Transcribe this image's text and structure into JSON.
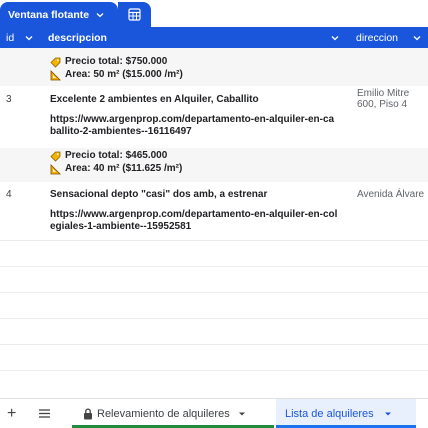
{
  "toolbar": {
    "view_tab_label": "Ventana flotante",
    "view_tab_icon": "chevron-down-icon",
    "table_icon": "table-icon"
  },
  "columns": {
    "id": "id",
    "description": "descripcion",
    "address": "direccion"
  },
  "rows": [
    {
      "id": "",
      "title": "",
      "url": "",
      "price": "Precio total: $750.000",
      "area": "Area:  50 m² ($15.000 /m²)",
      "address": ""
    },
    {
      "id": "3",
      "title": "Excelente 2 ambientes en Alquiler, Caballito",
      "url": "https://www.argenprop.com/departamento-en-alquiler-en-caballito-2-ambientes--16116497",
      "price": "Precio total: $465.000",
      "area": "Area:  40 m² ($11.625 /m²)",
      "address": "Emilio Mitre 600, Piso 4"
    },
    {
      "id": "4",
      "title": "Sensacional depto \"casi\" dos amb, a estrenar",
      "url": "https://www.argenprop.com/departamento-en-alquiler-en-colegiales-1-ambiente--15952581",
      "price": "",
      "area": "",
      "address": "Avenida Álvare"
    }
  ],
  "address_lines": {
    "row3_line1": "Emilio Mitre",
    "row3_line2": "600, Piso 4"
  },
  "sheets": {
    "add_label": "+",
    "tab1": "Relevamiento de alquileres",
    "tab2": "Lista de alquileres"
  },
  "colors": {
    "accent": "#1a56db",
    "tab1_underline": "#1e8e3e",
    "tab2_underline": "#1a73e8"
  }
}
